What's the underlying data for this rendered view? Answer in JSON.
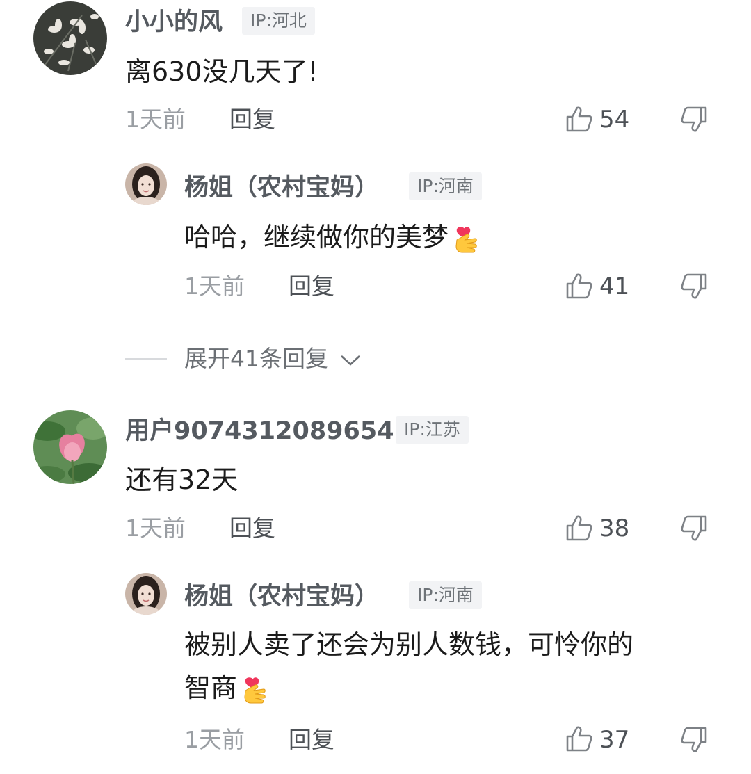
{
  "comments": [
    {
      "user": "小小的风",
      "ip": "IP:河北",
      "text": "离630没几天了!",
      "time": "1天前",
      "reply": "回复",
      "likes": "54",
      "replies": [
        {
          "user": "杨姐（农村宝妈）",
          "ip": "IP:河南",
          "text": "哈哈，继续做你的美梦",
          "time": "1天前",
          "reply": "回复",
          "likes": "41"
        }
      ],
      "expand": "展开41条回复"
    },
    {
      "user": "用户9074312089654",
      "ip": "IP:江苏",
      "text": "还有32天",
      "time": "1天前",
      "reply": "回复",
      "likes": "38",
      "replies": [
        {
          "user": "杨姐（农村宝妈）",
          "ip": "IP:河南",
          "text_line1": "被别人卖了还会为别人数钱，可怜你的",
          "text_line2": "智商",
          "time": "1天前",
          "reply": "回复",
          "likes": "37"
        }
      ]
    }
  ],
  "icons": {
    "like": "thumbs-up-outline",
    "dislike": "thumbs-down-outline",
    "expand": "chevron-down",
    "emoji": "finger-heart"
  }
}
